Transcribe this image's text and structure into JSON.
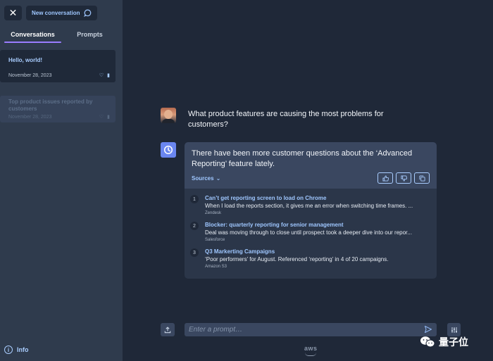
{
  "sidebar": {
    "new_conversation_label": "New conversation",
    "tabs": [
      {
        "label": "Conversations",
        "active": true
      },
      {
        "label": "Prompts",
        "active": false
      }
    ],
    "conversations": [
      {
        "title": "Hello, world!",
        "date": "November 28, 2023",
        "active": true
      },
      {
        "title": "Top product issues reported by customers",
        "date": "November 28, 2023",
        "active": false
      }
    ],
    "info_label": "Info"
  },
  "chat": {
    "user_message": "What product features are causing the most problems for customers?",
    "bot_message": "There have been more customer questions about the ‘Advanced Reporting’ feature lately.",
    "sources_label": "Sources",
    "sources": [
      {
        "num": "1",
        "title": "Can’t get reporting screen to load on Chrome",
        "snippet": "When I load the reports section, it gives me an error when switching time frames. ...",
        "origin": "Zendesk"
      },
      {
        "num": "2",
        "title": "Blocker: quarterly reporting for senior management",
        "snippet": "Deal was moving through to close until prospect took a deeper dive into our repor...",
        "origin": "Salesforce"
      },
      {
        "num": "3",
        "title": "Q3 Markerting Campaigns",
        "snippet": "‘Poor performers’ for August. Referenced ‘reporting’ in 4 of 20 campaigns.",
        "origin": "Amazon S3"
      }
    ]
  },
  "input": {
    "placeholder": "Enter a prompt…",
    "value": ""
  },
  "footer": {
    "logo_text": "aws",
    "watermark_text": "量子位"
  },
  "colors": {
    "background": "#1f2838",
    "sidebar": "#2f3b4d",
    "accent_link": "#9fc7ff",
    "tab_underline": "#9a7dff",
    "bubble": "#3a4760"
  }
}
